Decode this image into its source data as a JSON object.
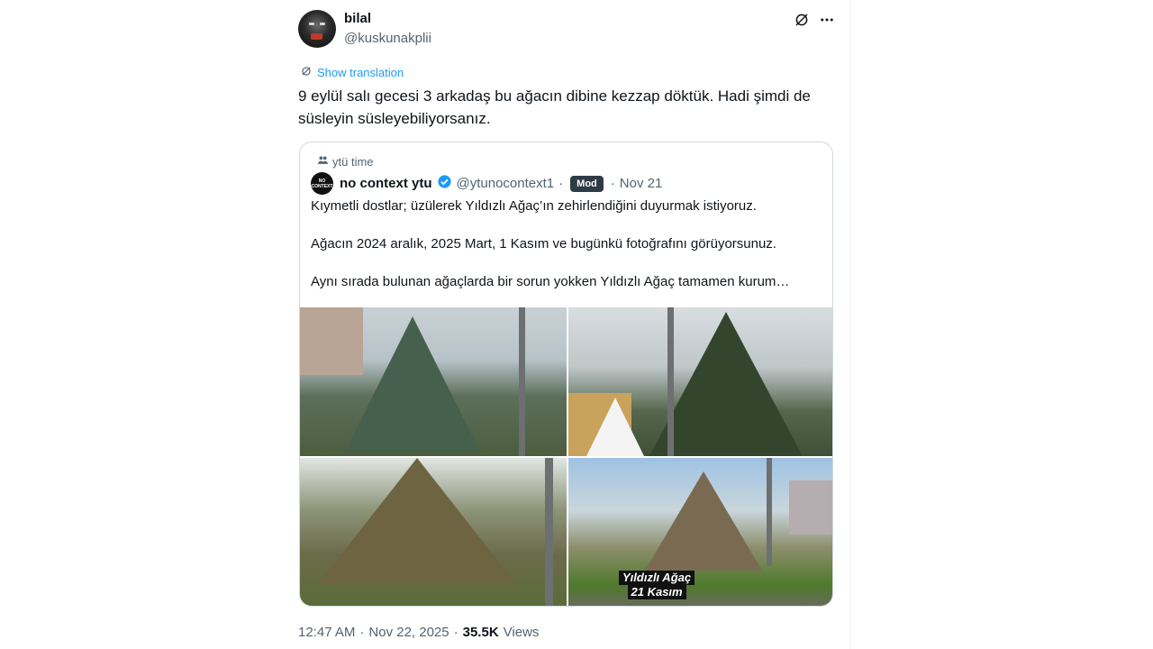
{
  "author": {
    "display_name": "bilal",
    "handle": "@kuskunakplii"
  },
  "actions": {
    "grok_icon": "grok-icon",
    "more_icon": "more-icon"
  },
  "translation": {
    "label": "Show translation",
    "icon": "translate-icon"
  },
  "tweet": {
    "text": "9 eylül salı gecesi 3 arkadaş bu ağacın dibine kezzap döktük. Hadi şimdi de süsleyin süsleyebiliyorsanız."
  },
  "quote": {
    "community": "ytü time",
    "author_name": "no context ytu",
    "verified": true,
    "author_handle": "@ytunocontext1",
    "badge": "Mod",
    "separator": "·",
    "date": "Nov 21",
    "avatar_text": "NO CONTEXT",
    "paragraphs": [
      "Kıymetli dostlar; üzülerek Yıldızlı Ağaç’ın zehirlendiğini duyurmak istiyoruz.",
      "Ağacın 2024 aralık, 2025 Mart, 1 Kasım ve bugünkü fotoğrafını görüyorsunuz.",
      "Aynı sırada bulunan ağaçlarda bir sorun yokken Yıldızlı Ağaç tamamen kurum…"
    ],
    "photo_caption_line1": "Yıldızlı Ağaç",
    "photo_caption_line2": "21 Kasım"
  },
  "meta": {
    "time": "12:47 AM",
    "separator": "·",
    "date": "Nov 22, 2025",
    "views_count": "35.5K",
    "views_label": "Views"
  },
  "colors": {
    "accent": "#1d9bf0",
    "secondary_text": "#536471",
    "border": "#cfd9de",
    "mod_badge": "#2f3b44"
  }
}
